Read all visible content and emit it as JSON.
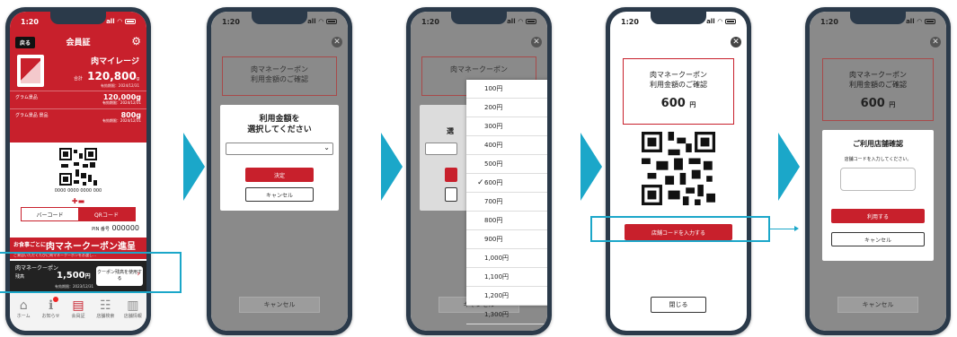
{
  "status": {
    "time": "1:20",
    "signal": "all"
  },
  "screen1": {
    "back_label": "戻る",
    "title": "会員証",
    "mileage_title": "肉マイレージ",
    "total_label": "合計",
    "total_value": "120,800",
    "total_unit": "g",
    "total_expiry": "有効期限：2024/12/31",
    "rows": [
      {
        "name": "グラム景品",
        "value": "120,000g",
        "expiry": "有効期限：2024/12/31"
      },
      {
        "name": "グラム景品 景品",
        "value": "800g",
        "expiry": "有効期限：2024/12/31"
      }
    ],
    "card_number": "0000 0000 0000 000",
    "tab_barcode": "バーコード",
    "tab_qr": "QRコード",
    "pin_label": "PIN 番号",
    "pin_value": "000000",
    "banner_a": "お食事ごとに!",
    "banner_b": "肉マネークーポン進呈",
    "banner_c": "ご来店いただくたびに肉マネークーポンをお渡し…",
    "coupon_name": "肉マネークーポン",
    "coupon_balance_label": "残高",
    "coupon_value": "1,500",
    "coupon_unit": "円",
    "coupon_expiry": "有効期限：2023/12/31",
    "coupon_btn": "クーポン残高を使用する",
    "nav": [
      "ホーム",
      "お知らせ",
      "会員証",
      "店舗検索",
      "店舗情報"
    ]
  },
  "screen2": {
    "box_title": "肉マネークーポン\n利用金額のご確認",
    "dialog_title": "利用金額を\n選択してください",
    "decide": "決定",
    "cancel": "キャンセル",
    "bottom_cancel": "キャンセル"
  },
  "screen3": {
    "box_title": "肉マネークーポン",
    "options": [
      "100円",
      "200円",
      "300円",
      "400円",
      "500円",
      "600円",
      "700円",
      "800円",
      "900円",
      "1,000円",
      "1,100円",
      "1,200円",
      "1,300円"
    ],
    "checked_index": 5,
    "check_mark": "✓",
    "partial_label": "選",
    "bottom_cancel": "キャンセル"
  },
  "screen4": {
    "box_title": "肉マネークーポン\n利用金額のご確認",
    "amount": "600",
    "unit": "円",
    "store_btn": "店舗コードを入力する",
    "close_btn": "閉じる"
  },
  "screen5": {
    "box_title": "肉マネークーポン\n利用金額のご確認",
    "amount": "600",
    "unit": "円",
    "dialog_title": "ご利用店舗確認",
    "dialog_sub": "店舗コードを入力してください。",
    "use_btn": "利用する",
    "cancel_btn": "キャンセル",
    "bottom_cancel": "キャンセル"
  }
}
